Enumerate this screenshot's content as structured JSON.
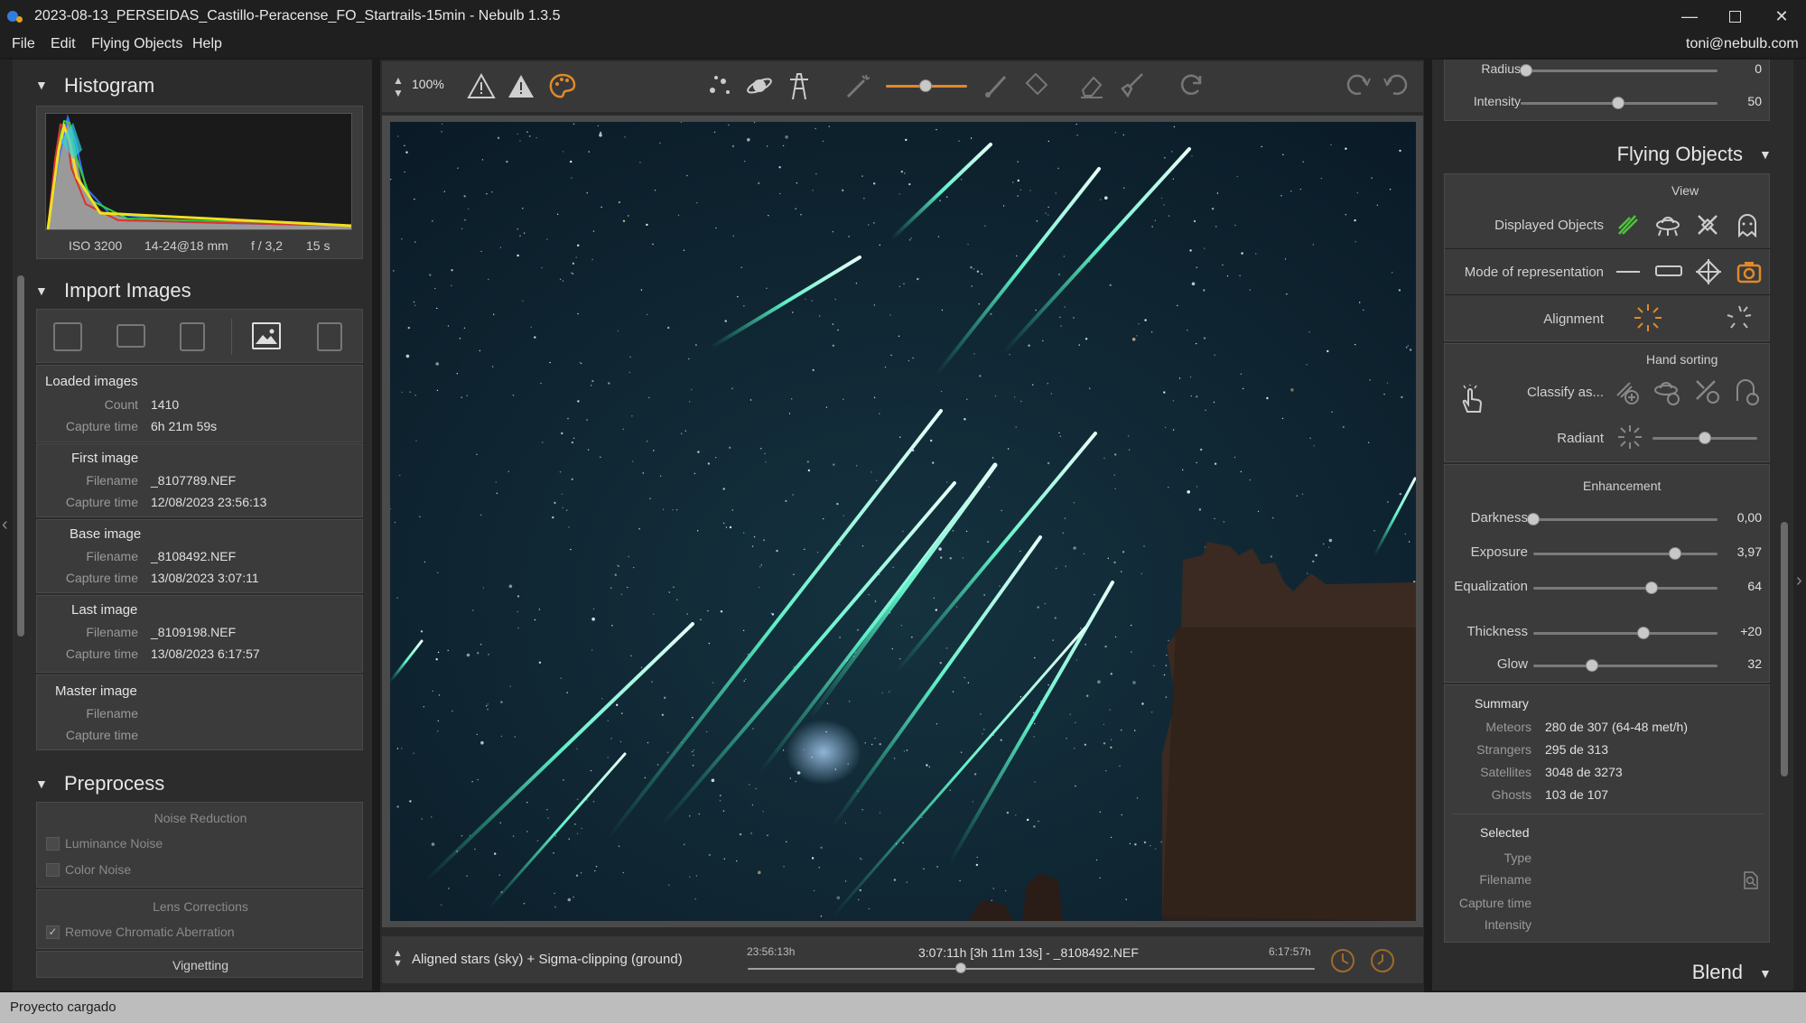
{
  "window": {
    "title": "2023-08-13_PERSEIDAS_Castillo-Peracense_FO_Startrails-15min - Nebulb 1.3.5"
  },
  "menu": {
    "items": [
      "File",
      "Edit",
      "Flying Objects",
      "Help"
    ],
    "user": "toni@nebulb.com"
  },
  "histogram": {
    "title": "Histogram",
    "iso": "ISO 3200",
    "lens": "14-24@18 mm",
    "aperture": "f / 3,2",
    "exposure": "15 s"
  },
  "import": {
    "title": "Import Images",
    "loaded": {
      "header": "Loaded images",
      "count_label": "Count",
      "count": "1410",
      "capture_label": "Capture time",
      "capture": "6h 21m 59s"
    },
    "first": {
      "header": "First image",
      "filename_label": "Filename",
      "filename": "_8107789.NEF",
      "capture_label": "Capture time",
      "capture": "12/08/2023 23:56:13"
    },
    "base": {
      "header": "Base image",
      "filename_label": "Filename",
      "filename": "_8108492.NEF",
      "capture_label": "Capture time",
      "capture": "13/08/2023 3:07:11"
    },
    "last": {
      "header": "Last image",
      "filename_label": "Filename",
      "filename": "_8109198.NEF",
      "capture_label": "Capture time",
      "capture": "13/08/2023 6:17:57"
    },
    "master": {
      "header": "Master image",
      "filename_label": "Filename",
      "capture_label": "Capture time"
    }
  },
  "preprocess": {
    "title": "Preprocess",
    "noise_header": "Noise Reduction",
    "luminance": "Luminance Noise",
    "color": "Color Noise",
    "lens_header": "Lens Corrections",
    "chromatic": "Remove Chromatic Aberration",
    "vignetting": "Vignetting"
  },
  "toolbar": {
    "zoom": "100%"
  },
  "bottom": {
    "mode": "Aligned stars (sky) + Sigma-clipping (ground)",
    "start": "23:56:13h",
    "current": "3:07:11h [3h 11m 13s] - _8108492.NEF",
    "end": "6:17:57h",
    "timeline_position": 0.375
  },
  "right": {
    "top_sliders": [
      {
        "label": "Radius",
        "value": "0",
        "pos": 0.0
      },
      {
        "label": "Intensity",
        "value": "50",
        "pos": 0.5
      }
    ],
    "title": "Flying Objects",
    "view_header": "View",
    "displayed_label": "Displayed Objects",
    "mode_label": "Mode of representation",
    "alignment_label": "Alignment",
    "hand_header": "Hand sorting",
    "classify_label": "Classify as...",
    "radiant_label": "Radiant",
    "radiant_pos": 0.5,
    "enh_header": "Enhancement",
    "enh_sliders": [
      {
        "label": "Darkness",
        "value": "0,00",
        "pos": 0.0
      },
      {
        "label": "Exposure",
        "value": "3,97",
        "pos": 0.77
      },
      {
        "label": "Equalization",
        "value": "64",
        "pos": 0.64
      },
      {
        "label": "Thickness",
        "value": "+20",
        "pos": 0.6
      },
      {
        "label": "Glow",
        "value": "32",
        "pos": 0.32
      }
    ],
    "summary_header": "Summary",
    "summary": [
      {
        "label": "Meteors",
        "value": "280 de 307 (64-48 met/h)"
      },
      {
        "label": "Strangers",
        "value": "295 de 313"
      },
      {
        "label": "Satellites",
        "value": "3048 de 3273"
      },
      {
        "label": "Ghosts",
        "value": "103 de 107"
      }
    ],
    "selected_header": "Selected",
    "selected": [
      {
        "label": "Type"
      },
      {
        "label": "Filename"
      },
      {
        "label": "Capture time"
      },
      {
        "label": "Intensity"
      }
    ],
    "blend": "Blend"
  },
  "status": {
    "text": "Proyecto cargado"
  },
  "colors": {
    "accent_orange": "#e08a2a",
    "accent_green": "#4fc23a",
    "sky": "#0c2030"
  }
}
